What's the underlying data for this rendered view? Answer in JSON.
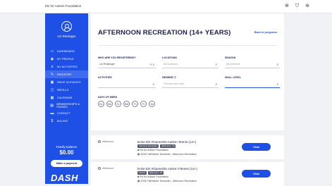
{
  "header": {
    "org_name": "Els for Autism Foundation",
    "icons": [
      "globe-icon",
      "cart-icon",
      "user-icon"
    ]
  },
  "sidebar": {
    "user_name": "Liz Reisinger",
    "items": [
      {
        "label": "DASHBOARD",
        "icon": "dashboard-icon",
        "glyph": "▭"
      },
      {
        "label": "MY PROFILE",
        "icon": "profile-icon",
        "glyph": "◉"
      },
      {
        "label": "MY ACTIVITIES",
        "icon": "activities-icon",
        "glyph": "♙"
      },
      {
        "label": "REGISTER",
        "icon": "register-icon",
        "glyph": "✎",
        "active": true
      },
      {
        "label": "DROP-IN EVENTS",
        "icon": "dropin-icon",
        "glyph": "▣"
      },
      {
        "label": "REFILLS",
        "icon": "refills-icon",
        "glyph": "▢"
      },
      {
        "label": "CALENDAR",
        "icon": "calendar-icon",
        "glyph": "▦"
      },
      {
        "label": "MEMBERSHIPS & PASSES",
        "icon": "pass-icon",
        "glyph": "▤"
      },
      {
        "label": "CONTACT",
        "icon": "contact-icon",
        "glyph": "▬"
      },
      {
        "label": "BILLING",
        "icon": "billing-icon",
        "glyph": "$"
      }
    ],
    "family_balance_label": "Family balance",
    "family_balance": "$0.00",
    "payment_button": "Make a payment",
    "brand": "DASH"
  },
  "page": {
    "title": "AFTERNOON RECREATION (14+ YEARS)",
    "back_link": "Back to programs"
  },
  "filters": {
    "who_label": "WHO ARE YOU REGISTERING?",
    "who_value": "Liz Reisinger",
    "locations_label": "LOCATIONS",
    "locations_placeholder": "All locations",
    "season_label": "SEASON",
    "season_placeholder": "All seasons",
    "activities_label": "ACTIVITIES",
    "activities_value": "",
    "gender_label": "GENDER",
    "gender_placeholder": "Female and coed",
    "skill_label": "SKILL LEVEL",
    "skill_value": "",
    "days_label": "DAYS OF WEEK",
    "days": [
      "Su",
      "Mo",
      "Tu",
      "We",
      "Th",
      "Fr",
      "Sa"
    ]
  },
  "programs": [
    {
      "time": "Afternoon",
      "name": "Ernie Els #GameON Autism Tennis (14+)",
      "tags": [
        "Afternoon Recreation",
        "Skill Level - Mi"
      ],
      "org": "Els for Autism Foundation",
      "season": "2026 Fall/Winter Semester - Afternoon Recreation",
      "button": "View"
    },
    {
      "time": "Afternoon",
      "name": "Ernie Els #GameON Autism Fitness (14+)",
      "tags": [
        "Fitness",
        "Skill Level - Mi"
      ],
      "org": "Els for Autism Foundation",
      "season": "2026 Fall/Winter Semester - Afternoon Recreation",
      "button": "View"
    }
  ]
}
